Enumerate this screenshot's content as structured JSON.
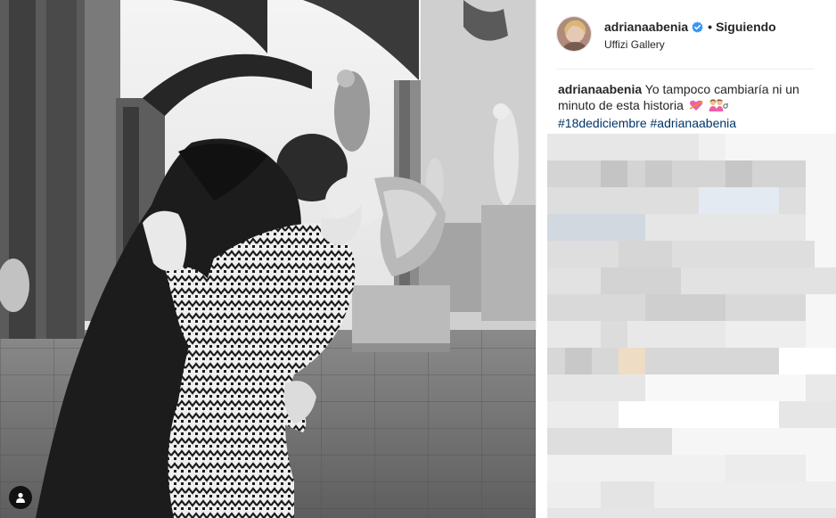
{
  "post": {
    "username": "adrianaabenia",
    "follow_status": "Siguiendo",
    "location": "Uffizi Gallery",
    "caption_text": "Yo tampoco cambiaría ni un minuto de esta historia",
    "hashtags": [
      "#18dediciembre",
      "#adrianaabenia"
    ]
  },
  "icons": {
    "verified": "verified-badge-icon",
    "tagged_people": "person-icon",
    "caption_emojis": [
      "heart-with-arrow-emoji",
      "couple-emoji"
    ]
  },
  "colors": {
    "verified_badge": "#3897f0",
    "hashtag_link": "#003569",
    "text": "#262626",
    "divider": "#efefef"
  }
}
